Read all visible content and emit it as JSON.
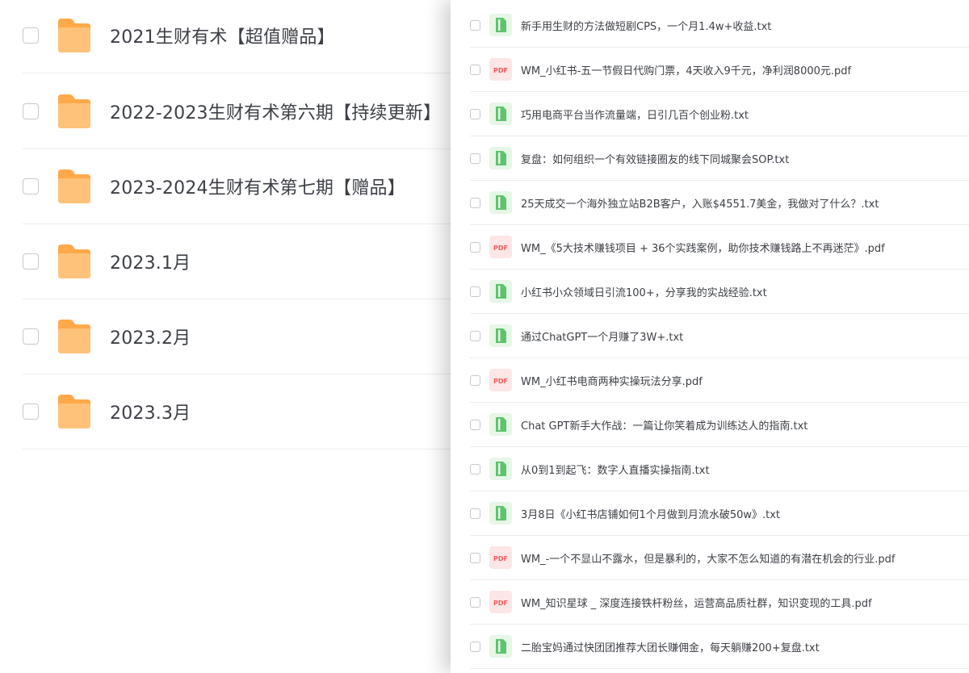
{
  "folders": [
    {
      "name": "2021生财有术【超值赠品】"
    },
    {
      "name": "2022-2023生财有术第六期【持续更新】"
    },
    {
      "name": "2023-2024生财有术第七期【赠品】"
    },
    {
      "name": "2023.1月"
    },
    {
      "name": "2023.2月"
    },
    {
      "name": "2023.3月"
    }
  ],
  "files": [
    {
      "type": "txt",
      "name": "新手用生财的方法做短剧CPS，一个月1.4w+收益.txt"
    },
    {
      "type": "pdf",
      "name": "WM_小红书-五一节假日代购门票，4天收入9千元，净利润8000元.pdf"
    },
    {
      "type": "txt",
      "name": "巧用电商平台当作流量端，日引几百个创业粉.txt"
    },
    {
      "type": "txt",
      "name": "复盘：如何组织一个有效链接圈友的线下同城聚会SOP.txt"
    },
    {
      "type": "txt",
      "name": "25天成交一个海外独立站B2B客户，入账$4551.7美金，我做对了什么？.txt"
    },
    {
      "type": "pdf",
      "name": "WM_《5大技术赚钱项目 + 36个实践案例，助你技术赚钱路上不再迷茫》.pdf"
    },
    {
      "type": "txt",
      "name": "小红书小众领域日引流100+，分享我的实战经验.txt"
    },
    {
      "type": "txt",
      "name": "通过ChatGPT一个月赚了3W+.txt"
    },
    {
      "type": "pdf",
      "name": "WM_小红书电商两种实操玩法分享.pdf"
    },
    {
      "type": "txt",
      "name": "Chat GPT新手大作战：一篇让你笑着成为训练达人的指南.txt"
    },
    {
      "type": "txt",
      "name": "从0到1到起飞：数字人直播实操指南.txt"
    },
    {
      "type": "txt",
      "name": "3月8日《小红书店铺如何1个月做到月流水破50w》.txt"
    },
    {
      "type": "pdf",
      "name": "WM_-一个不显山不露水，但是暴利的，大家不怎么知道的有潜在机会的行业.pdf"
    },
    {
      "type": "pdf",
      "name": "WM_知识星球 _ 深度连接铁杆粉丝，运营高品质社群，知识变现的工具.pdf"
    },
    {
      "type": "txt",
      "name": "二胎宝妈通过快团团推荐大团长赚佣金，每天躺赚200+复盘.txt"
    }
  ],
  "icons": {
    "pdf_label": "PDF"
  },
  "colors": {
    "folder": "#ffb45e",
    "txt_icon": "#5ec46b",
    "pdf_icon": "#f05a5a",
    "text": "#3c3f45",
    "divider": "#ececef"
  }
}
